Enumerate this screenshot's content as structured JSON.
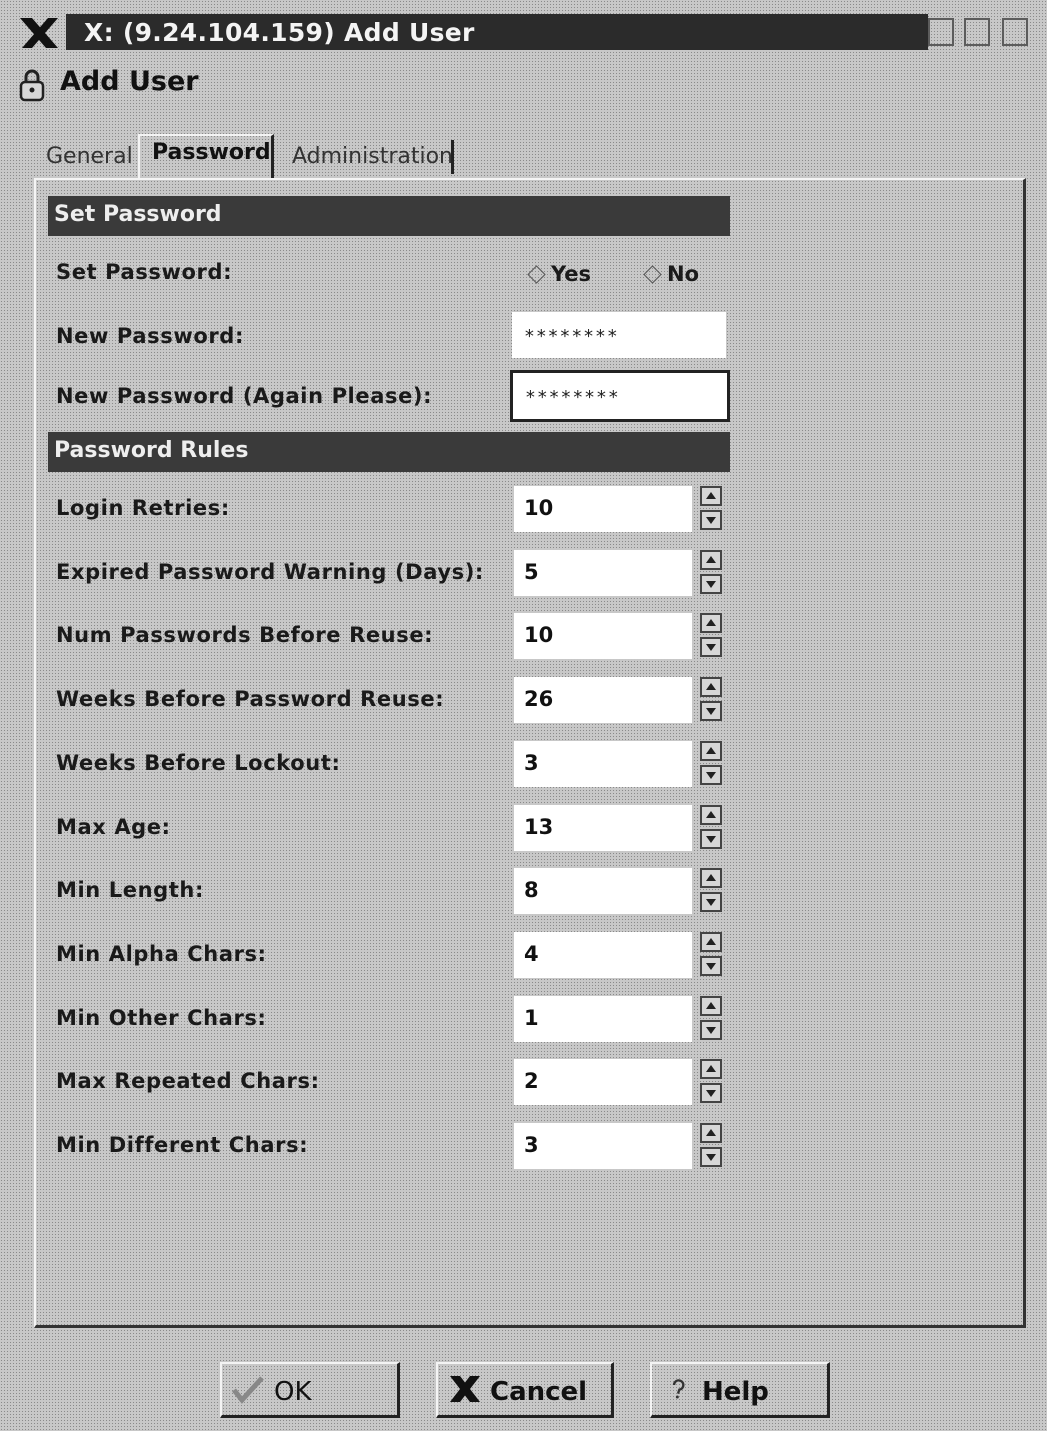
{
  "window": {
    "title": "X: (9.24.104.159) Add User"
  },
  "header": {
    "title": "Add User",
    "icon": "lock-icon"
  },
  "tabs": [
    {
      "label": "General",
      "active": false
    },
    {
      "label": "Password",
      "active": true
    },
    {
      "label": "Administration",
      "active": false
    }
  ],
  "set_password_section": {
    "heading": "Set Password",
    "set_password_label": "Set Password:",
    "radio_yes": "Yes",
    "radio_no": "No",
    "selected": "Yes",
    "new_password_label": "New Password:",
    "new_password_value": "********",
    "confirm_password_label": "New Password (Again Please):",
    "confirm_password_value": "********"
  },
  "password_rules_section": {
    "heading": "Password Rules",
    "rules": [
      {
        "label": "Login Retries:",
        "value": "10"
      },
      {
        "label": "Expired Password Warning (Days):",
        "value": "5"
      },
      {
        "label": "Num Passwords Before Reuse:",
        "value": "10"
      },
      {
        "label": "Weeks Before Password Reuse:",
        "value": "26"
      },
      {
        "label": "Weeks Before Lockout:",
        "value": "3"
      },
      {
        "label": "Max Age:",
        "value": "13"
      },
      {
        "label": "Min Length:",
        "value": "8"
      },
      {
        "label": "Min Alpha Chars:",
        "value": "4"
      },
      {
        "label": "Min Other Chars:",
        "value": "1"
      },
      {
        "label": "Max Repeated Chars:",
        "value": "2"
      },
      {
        "label": "Min Different Chars:",
        "value": "3"
      }
    ]
  },
  "buttons": {
    "ok": "OK",
    "cancel": "Cancel",
    "help": "Help"
  }
}
